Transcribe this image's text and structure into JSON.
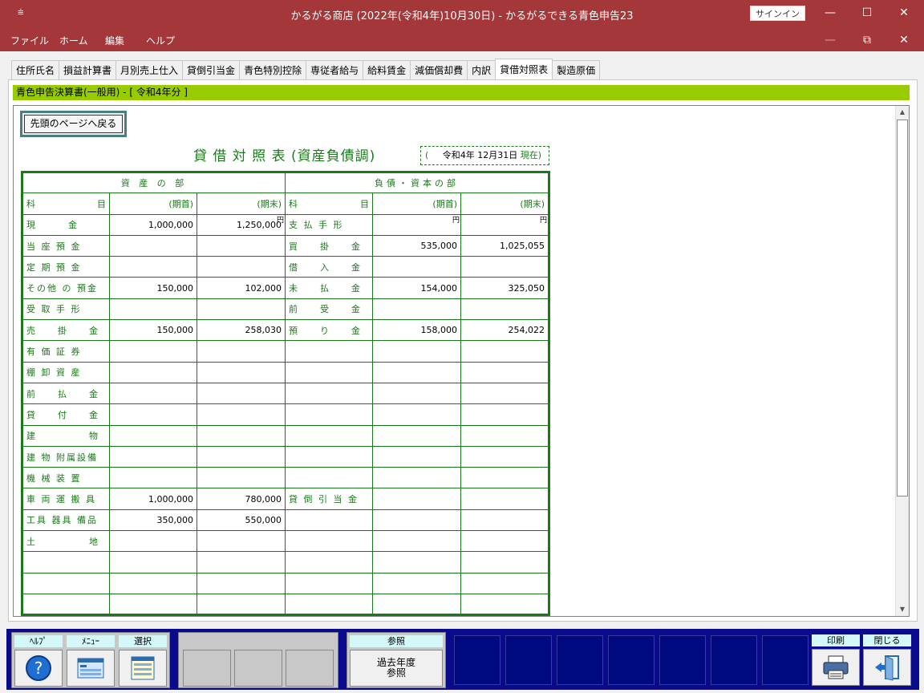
{
  "window": {
    "system_menu_glyph": "⩧",
    "title": "かるがる商店 (2022年(令和4年)10月30日)  -  かるがるできる青色申告23",
    "signin_label": "サインイン",
    "minimize_glyph": "—",
    "maximize_glyph": "☐",
    "close_glyph": "✕",
    "restore_glyph": "⧉"
  },
  "menu": [
    "ファイル",
    "ホーム",
    "編集",
    "ヘルプ"
  ],
  "tabs": [
    "住所氏名",
    "損益計算書",
    "月別売上仕入",
    "貸倒引当金",
    "青色特別控除",
    "専従者給与",
    "給料賃金",
    "減価償却費",
    "内訳",
    "貸借対照表",
    "製造原価"
  ],
  "active_tab": "貸借対照表",
  "header_bar": "青色申告決算書(一般用) - [ 令和4年分 ]",
  "top_button_label": "先頭のページへ戻る",
  "sheet": {
    "title": "貸 借 対 照 表 (資産負債調)",
    "as_of_open": "(",
    "as_of_date": "令和4年 12月31日",
    "as_of_close": "現在)",
    "assets_header": "資 産 の 部",
    "liabilities_header": "負債・資本の部",
    "col_item_a": "科",
    "col_item_b": "目",
    "col_begin": "(期首)",
    "col_end": "(期末)",
    "yen": "円",
    "rows": [
      {
        "asset": "現　　　金",
        "a_begin": "1,000,000",
        "a_end": "1,250,000",
        "liab": "支 払 手 形",
        "l_begin": "",
        "l_end": ""
      },
      {
        "asset": "当 座 預 金",
        "a_begin": "",
        "a_end": "",
        "liab": "買　　掛　　金",
        "l_begin": "535,000",
        "l_end": "1,025,055"
      },
      {
        "asset": "定 期 預 金",
        "a_begin": "",
        "a_end": "",
        "liab": "借　　入　　金",
        "l_begin": "",
        "l_end": ""
      },
      {
        "asset": "その他 の 預金",
        "a_begin": "150,000",
        "a_end": "102,000",
        "liab": "未　　払　　金",
        "l_begin": "154,000",
        "l_end": "325,050"
      },
      {
        "asset": "受 取 手 形",
        "a_begin": "",
        "a_end": "",
        "liab": "前　　受　　金",
        "l_begin": "",
        "l_end": ""
      },
      {
        "asset": "売　　掛　　金",
        "a_begin": "150,000",
        "a_end": "258,030",
        "liab": "預　　り　　金",
        "l_begin": "158,000",
        "l_end": "254,022"
      },
      {
        "asset": "有 価 証 券",
        "a_begin": "",
        "a_end": "",
        "liab": "",
        "l_begin": "",
        "l_end": ""
      },
      {
        "asset": "棚 卸 資 産",
        "a_begin": "",
        "a_end": "",
        "liab": "",
        "l_begin": "",
        "l_end": ""
      },
      {
        "asset": "前　　払　　金",
        "a_begin": "",
        "a_end": "",
        "liab": "",
        "l_begin": "",
        "l_end": ""
      },
      {
        "asset": "貸　　付　　金",
        "a_begin": "",
        "a_end": "",
        "liab": "",
        "l_begin": "",
        "l_end": ""
      },
      {
        "asset": "建　　　　　物",
        "a_begin": "",
        "a_end": "",
        "liab": "",
        "l_begin": "",
        "l_end": ""
      },
      {
        "asset": "建 物 附属設備",
        "a_begin": "",
        "a_end": "",
        "liab": "",
        "l_begin": "",
        "l_end": ""
      },
      {
        "asset": "機 械 装 置",
        "a_begin": "",
        "a_end": "",
        "liab": "",
        "l_begin": "",
        "l_end": ""
      },
      {
        "asset": "車 両 運 搬 具",
        "a_begin": "1,000,000",
        "a_end": "780,000",
        "liab": "貸 倒 引 当 金",
        "l_begin": "",
        "l_end": ""
      },
      {
        "asset": "工具 器具 備品",
        "a_begin": "350,000",
        "a_end": "550,000",
        "liab": "",
        "l_begin": "",
        "l_end": ""
      },
      {
        "asset": "土　　　　　地",
        "a_begin": "",
        "a_end": "",
        "liab": "",
        "l_begin": "",
        "l_end": ""
      },
      {
        "asset": "",
        "a_begin": "",
        "a_end": "",
        "liab": "",
        "l_begin": "",
        "l_end": ""
      },
      {
        "asset": "",
        "a_begin": "",
        "a_end": "",
        "liab": "",
        "l_begin": "",
        "l_end": ""
      },
      {
        "asset": "",
        "a_begin": "",
        "a_end": "",
        "liab": "",
        "l_begin": "",
        "l_end": ""
      }
    ]
  },
  "toolbar": {
    "help": "ﾍﾙﾌﾟ",
    "menu": "ﾒﾆｭｰ",
    "select": "選択",
    "reference_label": "参照",
    "reference_button_line1": "過去年度",
    "reference_button_line2": "参照",
    "print": "印刷",
    "close": "閉じる",
    "help_glyph": "?"
  }
}
